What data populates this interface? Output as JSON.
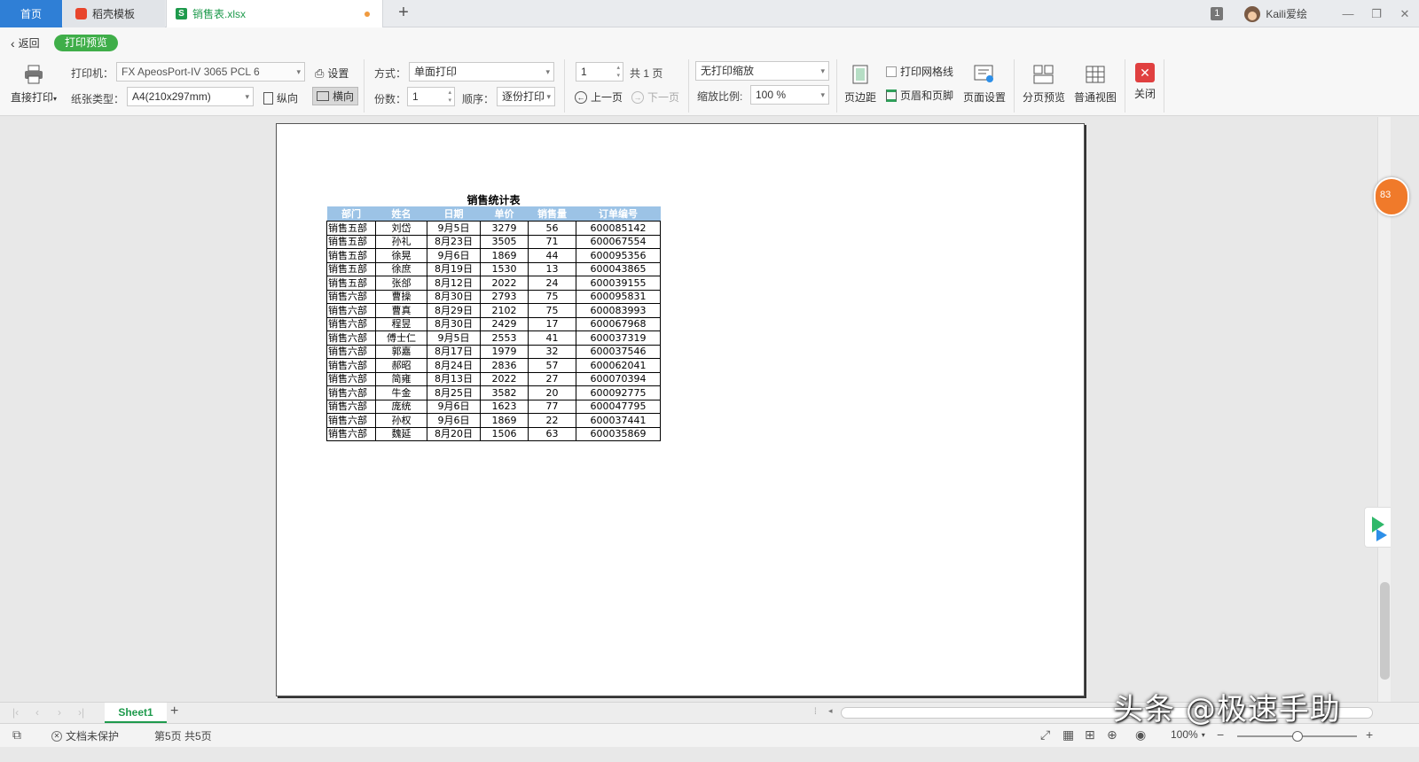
{
  "tabs": {
    "home": "首页",
    "template": "稻壳模板",
    "file": "销售表.xlsx",
    "badge": "1",
    "username": "Kaili爱绘"
  },
  "ribbon": {
    "back": "返回",
    "mode_badge": "打印预览",
    "direct_print": "直接打印",
    "printer_label": "打印机：",
    "printer_value": "FX ApeosPort-IV 3065 PCL 6",
    "settings": "设置",
    "paper_label": "纸张类型：",
    "paper_value": "A4(210x297mm)",
    "portrait": "纵向",
    "landscape": "横向",
    "method_label": "方式：",
    "method_value": "单面打印",
    "copies_label": "份数：",
    "copies_value": "1",
    "order_label": "顺序：",
    "order_value": "逐份打印",
    "page_value": "1",
    "page_total": "共 1 页",
    "prev_page": "上一页",
    "next_page": "下一页",
    "scale_mode": "无打印缩放",
    "scale_label": "缩放比例:",
    "scale_value": "100 %",
    "margins": "页边距",
    "print_gridlines": "打印网格线",
    "header_footer": "页眉和页脚",
    "page_setup": "页面设置",
    "page_break_preview": "分页预览",
    "normal_view": "普通视图",
    "close": "关闭"
  },
  "sheet": {
    "title": "销售统计表",
    "columns": [
      "部门",
      "姓名",
      "日期",
      "单价",
      "销售量",
      "订单编号"
    ],
    "rows": [
      [
        "销售五部",
        "刘岱",
        "9月5日",
        "3279",
        "56",
        "600085142"
      ],
      [
        "销售五部",
        "孙礼",
        "8月23日",
        "3505",
        "71",
        "600067554"
      ],
      [
        "销售五部",
        "徐晃",
        "9月6日",
        "1869",
        "44",
        "600095356"
      ],
      [
        "销售五部",
        "徐庶",
        "8月19日",
        "1530",
        "13",
        "600043865"
      ],
      [
        "销售五部",
        "张郃",
        "8月12日",
        "2022",
        "24",
        "600039155"
      ],
      [
        "销售六部",
        "曹操",
        "8月30日",
        "2793",
        "75",
        "600095831"
      ],
      [
        "销售六部",
        "曹真",
        "8月29日",
        "2102",
        "75",
        "600083993"
      ],
      [
        "销售六部",
        "程昱",
        "8月30日",
        "2429",
        "17",
        "600067968"
      ],
      [
        "销售六部",
        "傅士仁",
        "9月5日",
        "2553",
        "41",
        "600037319"
      ],
      [
        "销售六部",
        "郭嘉",
        "8月17日",
        "1979",
        "32",
        "600037546"
      ],
      [
        "销售六部",
        "郝昭",
        "8月24日",
        "2836",
        "57",
        "600062041"
      ],
      [
        "销售六部",
        "简雍",
        "8月13日",
        "2022",
        "27",
        "600070394"
      ],
      [
        "销售六部",
        "牛金",
        "8月25日",
        "3582",
        "20",
        "600092775"
      ],
      [
        "销售六部",
        "庞统",
        "9月6日",
        "1623",
        "77",
        "600047795"
      ],
      [
        "销售六部",
        "孙权",
        "9月6日",
        "1869",
        "22",
        "600037441"
      ],
      [
        "销售六部",
        "魏延",
        "8月20日",
        "1506",
        "63",
        "600035869"
      ]
    ]
  },
  "float_badge": "83",
  "sheetbar": {
    "sheet_name": "Sheet1"
  },
  "status": {
    "protection": "文档未保护",
    "page_info": "第5页 共5页",
    "zoom": "100%"
  },
  "watermark": "头条 @极速手助",
  "colors": {
    "accent_green": "#3fae49",
    "tab_blue": "#2f7fd6",
    "header_fill": "#9cc3e6",
    "close_red": "#e04040"
  }
}
